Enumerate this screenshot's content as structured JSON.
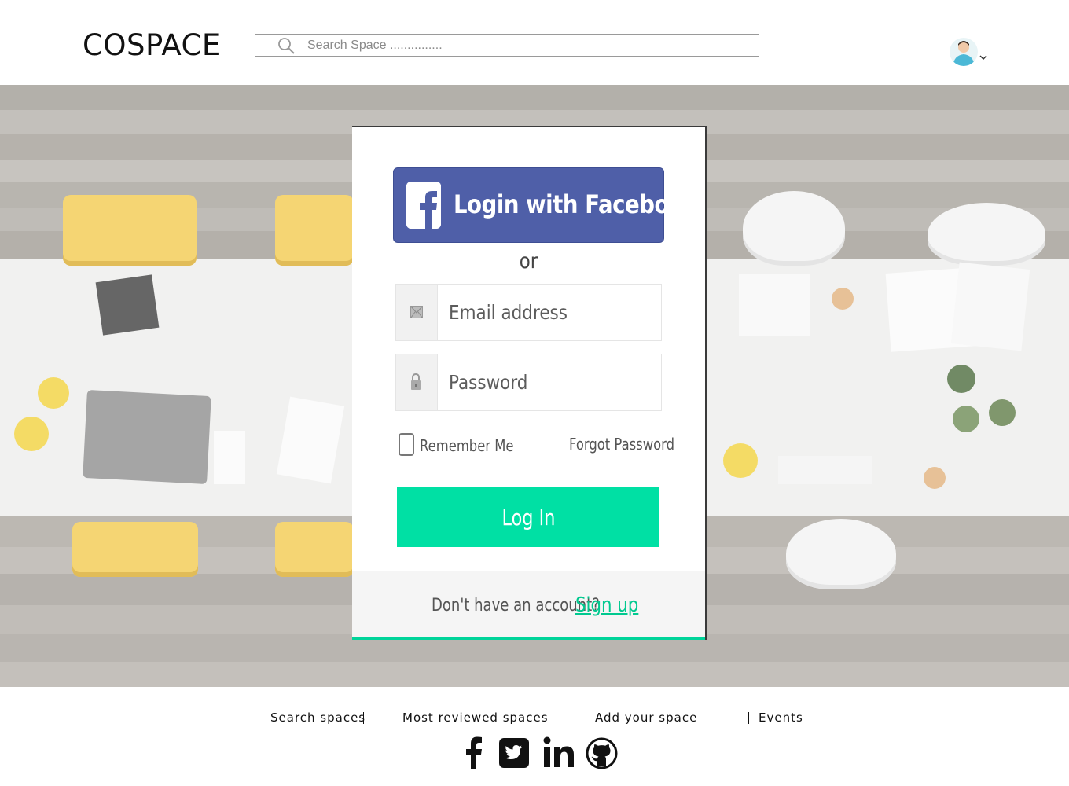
{
  "header": {
    "logo": "COSPACE",
    "search_placeholder": "Search Space ..............."
  },
  "login": {
    "facebook_label": "Login with Facebook",
    "or_text": "or",
    "email_placeholder": "Email address",
    "password_placeholder": "Password",
    "remember_label": "Remember Me",
    "forgot_label": "Forgot Password",
    "login_label": "Log In",
    "no_account_text": "Don't have an account?",
    "signup_label": "Sign up"
  },
  "footer": {
    "nav": [
      "Search spaces",
      "Most reviewed spaces",
      "Add your space",
      "Events"
    ],
    "social_icons": [
      "facebook-icon",
      "twitter-icon",
      "linkedin-icon",
      "github-icon"
    ]
  },
  "colors": {
    "accent": "#00e0a4",
    "facebook": "#4f5fa8",
    "signup": "#00c98f"
  }
}
